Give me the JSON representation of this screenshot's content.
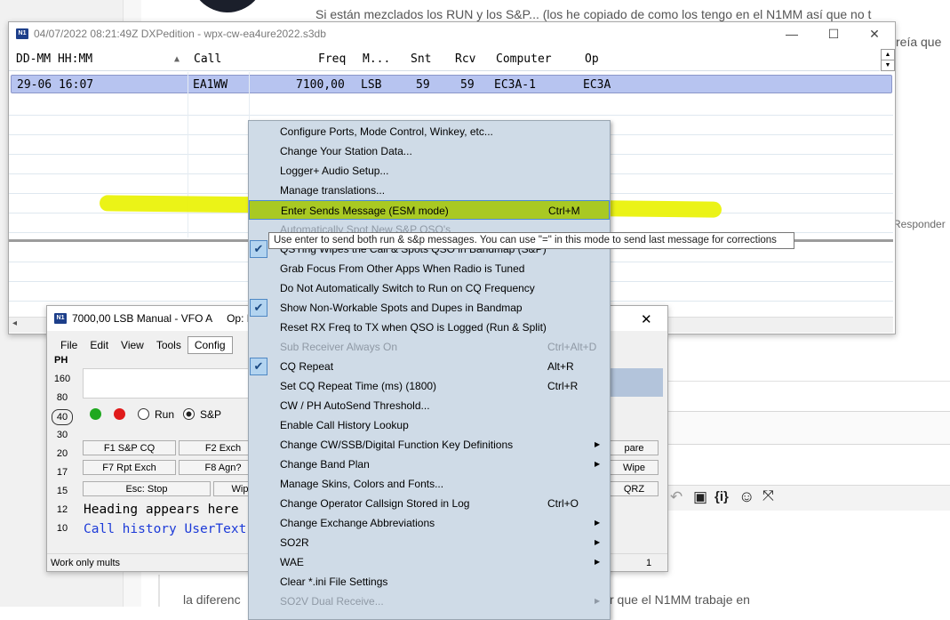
{
  "background_page": {
    "text_top": "Si están mezclados los RUN y los S&P... (los he copiado de como los tengo en el N1MM así que no t",
    "text_right": "reía que",
    "reply_link": "Responder",
    "bottom_text": "la diferenc",
    "bottom_text_2": "r que el N1MM trabaje en",
    "toolbar_icons": [
      "undo-icon",
      "paste-icon",
      "code-icon",
      "emoji-icon",
      "fullscreen-icon"
    ]
  },
  "log_window": {
    "title": "04/07/2022 08:21:49Z  DXPedition - wpx-cw-ea4ure2022.s3db",
    "columns": [
      "DD-MM HH:MM",
      "Call",
      "Freq",
      "M...",
      "Snt",
      "Rcv",
      "Computer",
      "Op"
    ],
    "rows": [
      {
        "datetime": "29-06 16:07",
        "call": "EA1WW",
        "freq": "7100,00",
        "mode": "LSB",
        "snt": "59",
        "rcv": "59",
        "computer": "EC3A-1",
        "op": "EC3A"
      }
    ],
    "controls": {
      "minimize": "—",
      "maximize": "☐",
      "close": "✕"
    }
  },
  "entry_window": {
    "title": "7000,00 LSB Manual - VFO A",
    "title_op": "Op: EC",
    "menus": [
      "File",
      "Edit",
      "View",
      "Tools",
      "Config"
    ],
    "mode": "PH",
    "bands": [
      "160",
      "80",
      "40",
      "30",
      "20",
      "17",
      "15",
      "12",
      "10"
    ],
    "selected_band": "40",
    "run_label": "Run",
    "sp_label": "S&P",
    "fkeys_row1": [
      "F1 S&P CQ",
      "F2 Exch"
    ],
    "fkeys_row2": [
      "F7 Rpt Exch",
      "F8 Agn?"
    ],
    "fkeys_row3": [
      "Esc: Stop",
      "Wip"
    ],
    "fkeys_right": [
      "pare",
      "Wipe",
      "QRZ"
    ],
    "heading_text": "Heading appears here",
    "call_history_text": "Call history UserText",
    "status_left": "Work only mults",
    "status_right": "1",
    "close": "✕"
  },
  "context_menu": {
    "items": [
      {
        "label": "Configure Ports, Mode Control, Winkey, etc...",
        "shortcut": "",
        "checked": false,
        "disabled": false,
        "submenu": false
      },
      {
        "label": "Change Your Station Data...",
        "shortcut": "",
        "checked": false,
        "disabled": false,
        "submenu": false
      },
      {
        "label": "Logger+ Audio Setup...",
        "shortcut": "",
        "checked": false,
        "disabled": false,
        "submenu": false
      },
      {
        "label": "Manage translations...",
        "shortcut": "",
        "checked": false,
        "disabled": false,
        "submenu": false
      },
      {
        "label": "Enter Sends Message (ESM mode)",
        "shortcut": "Ctrl+M",
        "checked": false,
        "disabled": false,
        "submenu": false,
        "highlighted": true
      },
      {
        "label": "Automatically Spot New S&P QSO's",
        "shortcut": "",
        "checked": false,
        "disabled": true,
        "submenu": false
      },
      {
        "label": "QSYing Wipes the Call & Spots QSO in Bandmap (S&P)",
        "shortcut": "",
        "checked": true,
        "disabled": false,
        "submenu": false
      },
      {
        "label": "Grab Focus From Other Apps When Radio is Tuned",
        "shortcut": "",
        "checked": false,
        "disabled": false,
        "submenu": false
      },
      {
        "label": "Do Not Automatically Switch to Run on CQ Frequency",
        "shortcut": "",
        "checked": false,
        "disabled": false,
        "submenu": false
      },
      {
        "label": "Show Non-Workable Spots and Dupes in Bandmap",
        "shortcut": "",
        "checked": true,
        "disabled": false,
        "submenu": false
      },
      {
        "label": "Reset RX Freq to TX when QSO is Logged (Run & Split)",
        "shortcut": "",
        "checked": false,
        "disabled": false,
        "submenu": false
      },
      {
        "label": "Sub Receiver Always On",
        "shortcut": "Ctrl+Alt+D",
        "checked": false,
        "disabled": true,
        "submenu": false
      },
      {
        "label": "CQ Repeat",
        "shortcut": "Alt+R",
        "checked": true,
        "disabled": false,
        "submenu": false
      },
      {
        "label": "Set CQ Repeat Time (ms) (1800)",
        "shortcut": "Ctrl+R",
        "checked": false,
        "disabled": false,
        "submenu": false
      },
      {
        "label": "CW / PH AutoSend Threshold...",
        "shortcut": "",
        "checked": false,
        "disabled": false,
        "submenu": false
      },
      {
        "label": "Enable Call History Lookup",
        "shortcut": "",
        "checked": false,
        "disabled": false,
        "submenu": false
      },
      {
        "label": "Change CW/SSB/Digital Function Key Definitions",
        "shortcut": "",
        "checked": false,
        "disabled": false,
        "submenu": true
      },
      {
        "label": "Change Band Plan",
        "shortcut": "",
        "checked": false,
        "disabled": false,
        "submenu": true
      },
      {
        "label": "Manage Skins, Colors and Fonts...",
        "shortcut": "",
        "checked": false,
        "disabled": false,
        "submenu": false
      },
      {
        "label": "Change Operator Callsign Stored in Log",
        "shortcut": "Ctrl+O",
        "checked": false,
        "disabled": false,
        "submenu": false
      },
      {
        "label": "Change Exchange Abbreviations",
        "shortcut": "",
        "checked": false,
        "disabled": false,
        "submenu": true
      },
      {
        "label": "SO2R",
        "shortcut": "",
        "checked": false,
        "disabled": false,
        "submenu": true
      },
      {
        "label": "WAE",
        "shortcut": "",
        "checked": false,
        "disabled": false,
        "submenu": true
      },
      {
        "label": "Clear *.ini File Settings",
        "shortcut": "",
        "checked": false,
        "disabled": false,
        "submenu": false
      },
      {
        "label": "SO2V Dual Receive...",
        "shortcut": "",
        "checked": false,
        "disabled": true,
        "submenu": true
      }
    ]
  },
  "tooltip": {
    "text": "Use enter to send both run & s&p messages. You can use \"=\" in this mode to send last message for corrections"
  },
  "colors": {
    "menu_bg": "#cfdbe7",
    "highlight_marker": "#e9f20a",
    "selected_row": "#b7c4f0",
    "call_history_text": "#1c3ad8"
  }
}
